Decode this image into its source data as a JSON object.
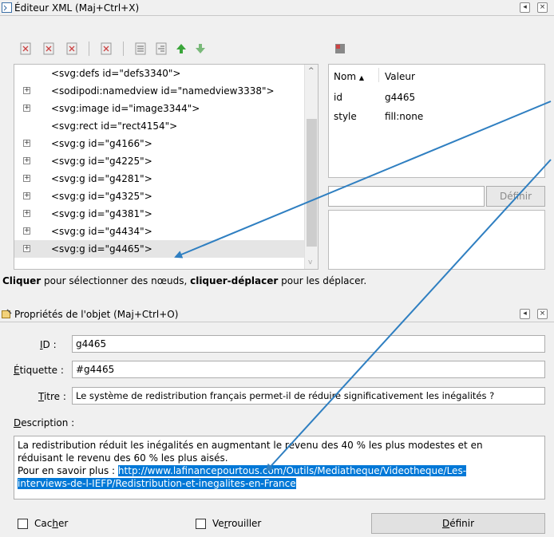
{
  "xml_editor": {
    "title": "Éditeur XML (Maj+Ctrl+X)",
    "nodes": [
      {
        "label": "<svg:defs id=\"defs3340\">",
        "expandable": false
      },
      {
        "label": "<sodipodi:namedview id=\"namedview3338\">",
        "expandable": true
      },
      {
        "label": "<svg:image id=\"image3344\">",
        "expandable": true
      },
      {
        "label": "<svg:rect id=\"rect4154\">",
        "expandable": false
      },
      {
        "label": "<svg:g id=\"g4166\">",
        "expandable": true
      },
      {
        "label": "<svg:g id=\"g4225\">",
        "expandable": true
      },
      {
        "label": "<svg:g id=\"g4281\">",
        "expandable": true
      },
      {
        "label": "<svg:g id=\"g4325\">",
        "expandable": true
      },
      {
        "label": "<svg:g id=\"g4381\">",
        "expandable": true
      },
      {
        "label": "<svg:g id=\"g4434\">",
        "expandable": true
      },
      {
        "label": "<svg:g id=\"g4465\">",
        "expandable": true
      }
    ],
    "attributes": {
      "col_name": "Nom",
      "col_value": "Valeur",
      "rows": [
        {
          "name": "id",
          "value": "g4465"
        },
        {
          "name": "style",
          "value": "fill:none"
        }
      ]
    },
    "set_button": "Définir",
    "hint_bold1": "Cliquer",
    "hint_text1": " pour sélectionner des nœuds, ",
    "hint_bold2": "cliquer-déplacer",
    "hint_text2": " pour les déplacer."
  },
  "object_properties": {
    "title": "Propriétés de l'objet (Maj+Ctrl+O)",
    "id_label": "D :",
    "id_label_u": "I",
    "id_value": "g4465",
    "label_label_u": "É",
    "label_label": "tiquette :",
    "label_value": "#g4465",
    "title_label_u": "T",
    "title_label": "itre :",
    "title_value": "Le système de redistribution français permet-il de réduire significativement les inégalités ?",
    "description_label_u": "D",
    "description_label": "escription :",
    "description_line1": "La redistribution réduit les inégalités en augmentant le revenu des 40 % les plus modestes et en",
    "description_line2": "réduisant le revenu des 60 % les plus aisés.",
    "description_line3_prefix": "Pour en savoir plus : ",
    "description_link1": "http://www.lafinancepourtous.com/Outils/Mediatheque/Videotheque/Les-",
    "description_link2": "interviews-de-l-IEFP/Redistribution-et-inegalites-en-France",
    "hide_label_a": "Cac",
    "hide_label_u": "h",
    "hide_label_b": "er",
    "lock_label_a": "Ve",
    "lock_label_u": "r",
    "lock_label_b": "rouiller",
    "set_button_u": "D",
    "set_button": "éfinir"
  },
  "colors": {
    "selection": "#0078d7",
    "arrow": "#2f7fc1",
    "add_green": "#3aa53a"
  }
}
